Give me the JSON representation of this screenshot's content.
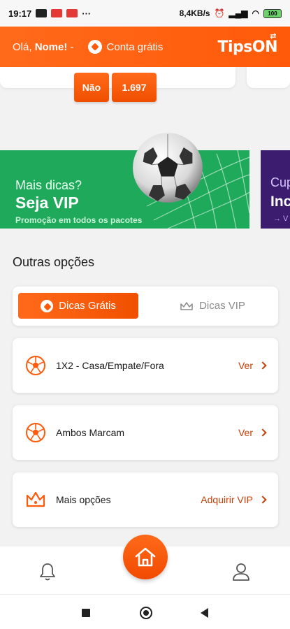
{
  "status_bar": {
    "time": "19:17",
    "dots": "···",
    "network_speed": "8,4KB/s",
    "battery": "100"
  },
  "header": {
    "greeting_prefix": "Olá,",
    "greeting_name": "Nome!",
    "greeting_suffix": "-",
    "free_account": "Conta grátis",
    "logo": "TipsON"
  },
  "odds": {
    "label": "Não",
    "value": "1.697"
  },
  "banner_vip": {
    "line1": "Mais dicas?",
    "line2": "Seja VIP",
    "line3": "Promoção em todos os pacotes",
    "bg_color": "#1eaa5a"
  },
  "banner_next": {
    "line1": "Cup",
    "line2": "Inc",
    "line3": "→ V",
    "bg_color": "#3c1c6e"
  },
  "section_title": "Outras opções",
  "tabs": {
    "free": "Dicas Grátis",
    "vip": "Dicas VIP"
  },
  "options": [
    {
      "label": "1X2 - Casa/Empate/Fora",
      "action": "Ver",
      "icon": "soccer-ball-icon"
    },
    {
      "label": "Ambos Marcam",
      "action": "Ver",
      "icon": "soccer-ball-icon"
    },
    {
      "label": "Mais opções",
      "action": "Adquirir VIP",
      "icon": "crown-icon"
    }
  ],
  "colors": {
    "accent": "#ff5a0a",
    "action_text": "#c43f05"
  }
}
